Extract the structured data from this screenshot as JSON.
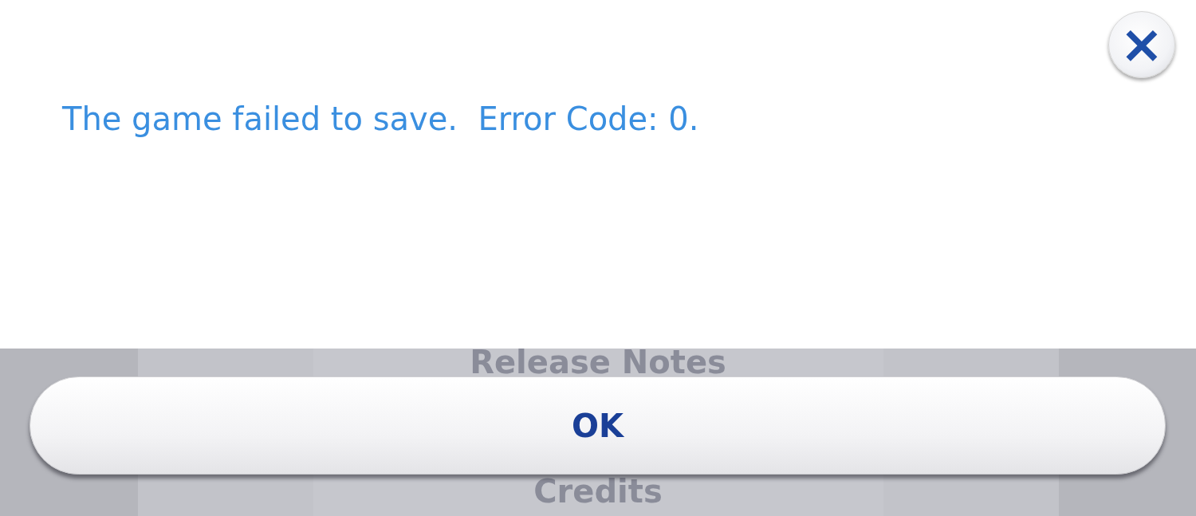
{
  "dialog": {
    "message": "The game failed to save.  Error Code: 0.",
    "close_button": {
      "label": "×"
    },
    "buttons": [
      {
        "label": "OK"
      }
    ]
  },
  "background_menu": {
    "items": [
      {
        "label": "Release Notes"
      },
      {
        "label": "Credits"
      }
    ]
  }
}
